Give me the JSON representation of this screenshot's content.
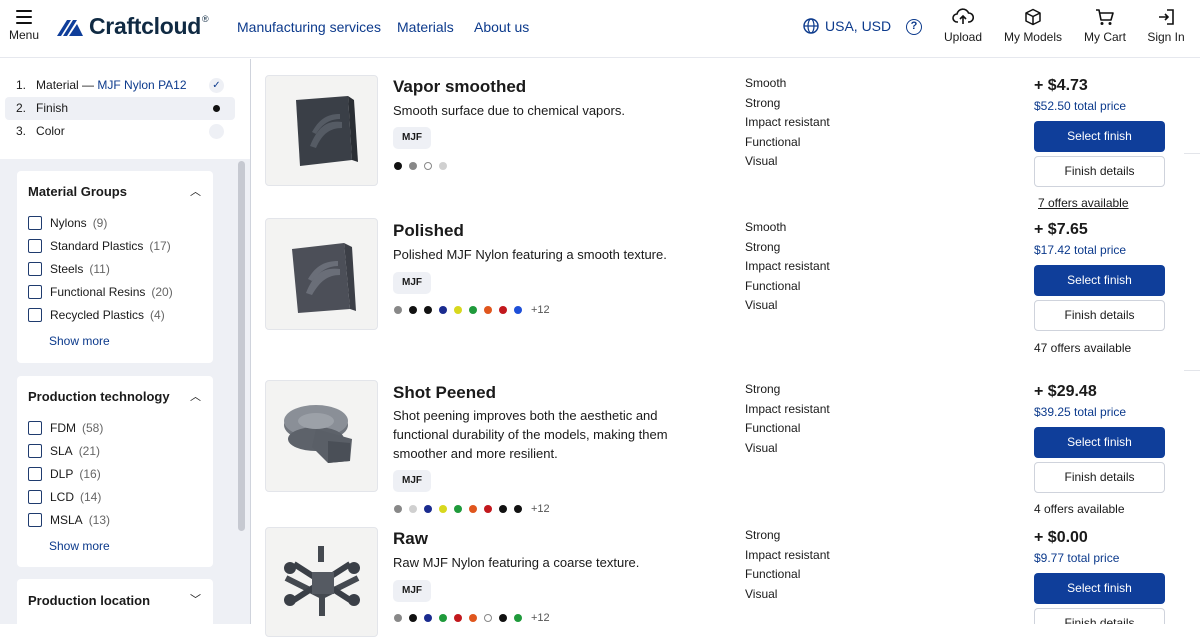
{
  "header": {
    "menu_label": "Menu",
    "brand": "Craftcloud",
    "brand_mark": "®",
    "nav": [
      "Manufacturing services",
      "Materials",
      "About us"
    ],
    "region": "USA, USD",
    "help": "?",
    "actions": {
      "upload": "Upload",
      "models": "My Models",
      "cart": "My Cart",
      "signin": "Sign In"
    }
  },
  "steps": [
    {
      "num": "1.",
      "label": "Material —",
      "value": "MJF Nylon PA12",
      "state": "done"
    },
    {
      "num": "2.",
      "label": "Finish",
      "state": "current"
    },
    {
      "num": "3.",
      "label": "Color",
      "state": "todo"
    }
  ],
  "filters": {
    "material_groups": {
      "title": "Material Groups",
      "items": [
        {
          "label": "Nylons",
          "count": "(9)"
        },
        {
          "label": "Standard Plastics",
          "count": "(17)"
        },
        {
          "label": "Steels",
          "count": "(11)"
        },
        {
          "label": "Functional Resins",
          "count": "(20)"
        },
        {
          "label": "Recycled Plastics",
          "count": "(4)"
        }
      ],
      "show_more": "Show more"
    },
    "production_technology": {
      "title": "Production technology",
      "items": [
        {
          "label": "FDM",
          "count": "(58)"
        },
        {
          "label": "SLA",
          "count": "(21)"
        },
        {
          "label": "DLP",
          "count": "(16)"
        },
        {
          "label": "LCD",
          "count": "(14)"
        },
        {
          "label": "MSLA",
          "count": "(13)"
        }
      ],
      "show_more": "Show more"
    },
    "production_location": {
      "title": "Production location"
    }
  },
  "finishes": [
    {
      "name": "Vapor smoothed",
      "description": "Smooth surface due to chemical vapors.",
      "badge": "MJF",
      "swatches": [
        "#111111",
        "#888888",
        "ring",
        "#d0d0d0"
      ],
      "more": "",
      "properties": [
        "Smooth",
        "Strong",
        "Impact resistant",
        "Functional",
        "Visual"
      ],
      "price": "+ $4.73",
      "total": "$52.50 total price",
      "select": "Select finish",
      "details": "Finish details",
      "offers": "7 offers available"
    },
    {
      "name": "Polished",
      "description": "Polished MJF Nylon featuring a smooth texture.",
      "badge": "MJF",
      "swatches": [
        "#888888",
        "#111111",
        "#111111",
        "#1a2b8f",
        "#d8d81e",
        "#1f9a3b",
        "#e0561d",
        "#c2181d",
        "#1e4fd8"
      ],
      "more": "+12",
      "properties": [
        "Smooth",
        "Strong",
        "Impact resistant",
        "Functional",
        "Visual"
      ],
      "price": "+ $7.65",
      "total": "$17.42 total price",
      "select": "Select finish",
      "details": "Finish details",
      "offers": "47 offers available"
    },
    {
      "name": "Shot Peened",
      "description": "Shot peening improves both the aesthetic and functional durability of the models, making them smoother and more resilient.",
      "badge": "MJF",
      "swatches": [
        "#888888",
        "#d0d0d0",
        "#1a2b8f",
        "#d8d81e",
        "#1f9a3b",
        "#e0561d",
        "#c2181d",
        "#111111",
        "#111111"
      ],
      "more": "+12",
      "properties": [
        "Strong",
        "Impact resistant",
        "Functional",
        "Visual"
      ],
      "price": "+ $29.48",
      "total": "$39.25 total price",
      "select": "Select finish",
      "details": "Finish details",
      "offers": "4 offers available"
    },
    {
      "name": "Raw",
      "description": "Raw MJF Nylon featuring a coarse texture.",
      "badge": "MJF",
      "swatches": [
        "#888888",
        "#111111",
        "#1a2b8f",
        "#1f9a3b",
        "#c2181d",
        "#e0561d",
        "ring",
        "#111111",
        "#1f9a3b"
      ],
      "more": "+12",
      "properties": [
        "Strong",
        "Impact resistant",
        "Functional",
        "Visual"
      ],
      "price": "+ $0.00",
      "total": "$9.77 total price",
      "select": "Select finish",
      "details": "Finish details",
      "offers": ""
    }
  ]
}
